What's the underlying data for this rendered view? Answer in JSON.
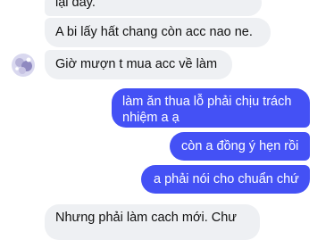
{
  "thread": {
    "messages": [
      {
        "id": "m1",
        "sender": "other",
        "text": "lại đây."
      },
      {
        "id": "m2",
        "sender": "other",
        "text": "A bi lấy hất chang còn acc nao ne."
      },
      {
        "id": "m3",
        "sender": "other",
        "text": "Giờ mượn t mua acc về làm"
      },
      {
        "id": "m4",
        "sender": "me",
        "lines": [
          "làm ăn thua lỗ phải chịu trách",
          "nhiệm a ạ"
        ]
      },
      {
        "id": "m5",
        "sender": "me",
        "text": "còn a đồng ý hẹn rồi"
      },
      {
        "id": "m6",
        "sender": "me",
        "text": "a phải nói cho chuẩn chứ"
      },
      {
        "id": "m7",
        "sender": "other",
        "text": "Nhưng phải làm cach mới. Chư"
      }
    ]
  },
  "colors": {
    "incoming_bubble": "#eef0f3",
    "outgoing_bubble": "#4451f5"
  }
}
